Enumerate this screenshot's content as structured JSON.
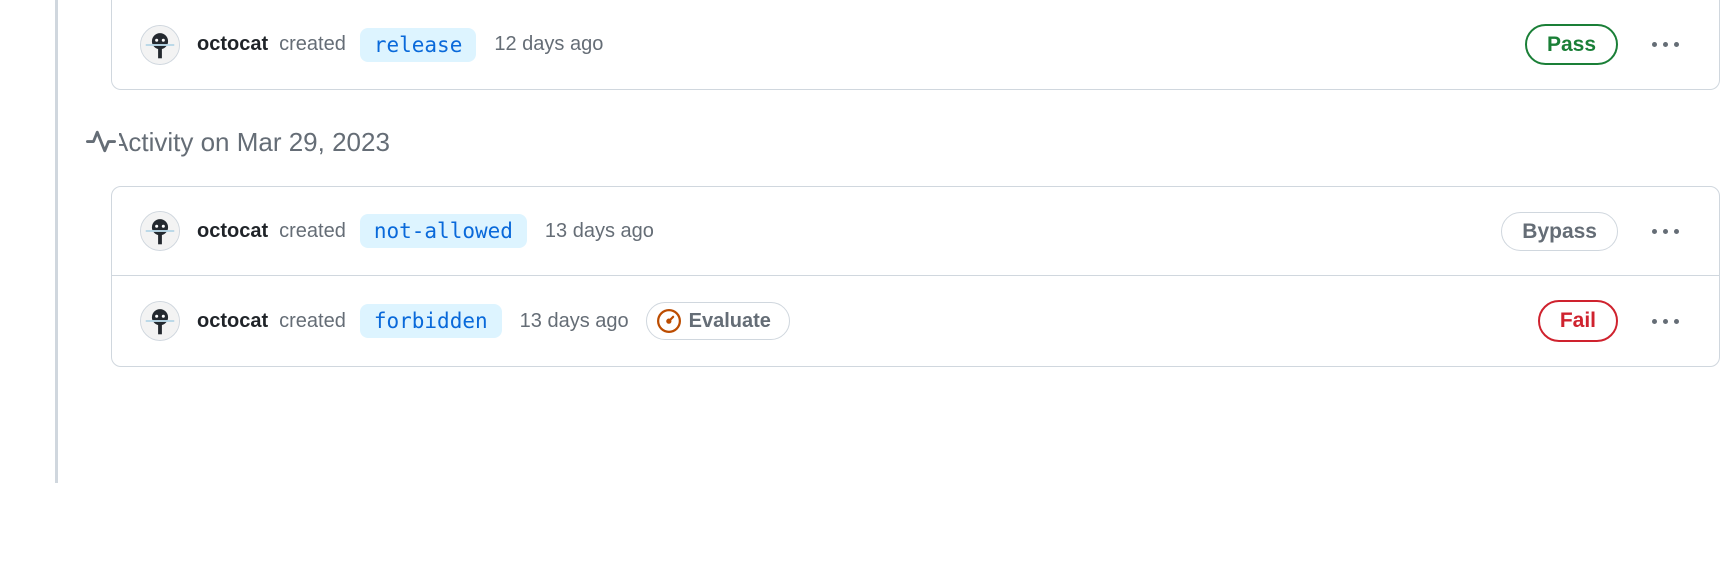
{
  "section": {
    "title": "Activity on Mar 29, 2023"
  },
  "status": {
    "pass": "Pass",
    "bypass": "Bypass",
    "fail": "Fail",
    "evaluate": "Evaluate"
  },
  "events": [
    {
      "actor": "octocat",
      "action": "created",
      "branch": "release",
      "time": "12 days ago",
      "status": "pass",
      "evaluate": false
    },
    {
      "actor": "octocat",
      "action": "created",
      "branch": "not-allowed",
      "time": "13 days ago",
      "status": "bypass",
      "evaluate": false
    },
    {
      "actor": "octocat",
      "action": "created",
      "branch": "forbidden",
      "time": "13 days ago",
      "status": "fail",
      "evaluate": true
    }
  ]
}
